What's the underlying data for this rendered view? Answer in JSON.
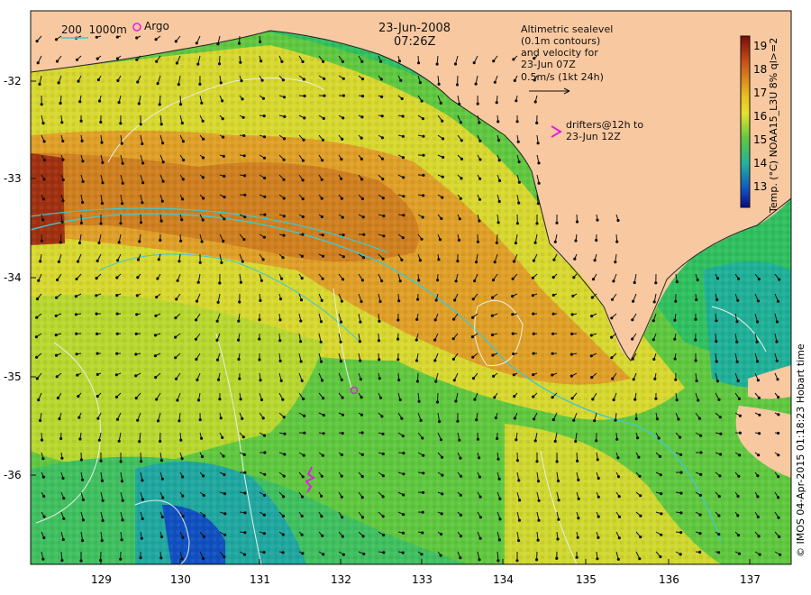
{
  "map": {
    "date": "23-Jun-2008",
    "time": "07:26Z",
    "scale_label": "200  1000m",
    "argo_label": "Argo",
    "legend_lines": [
      "Altimetric sealevel",
      "(0.1m contours)",
      "and velocity for",
      "23-Jun 07Z",
      "0.5m/s (1kt 24h)"
    ],
    "drifters_lines": [
      "drifters@12h to",
      "23-Jun 12Z"
    ],
    "y_ticks": [
      "-32",
      "-33",
      "-34",
      "-35",
      "-36"
    ],
    "x_ticks": [
      "129",
      "130",
      "131",
      "132",
      "133",
      "134",
      "135",
      "136",
      "137"
    ],
    "colorbar": {
      "title": "Temp. (°C) NOAA15_L3U 8% ql>=2",
      "ticks": [
        "19",
        "18",
        "17",
        "16",
        "15",
        "14",
        "13"
      ],
      "colors": [
        "#7a0a0a",
        "#c8501a",
        "#e0a020",
        "#e8e030",
        "#60c840",
        "#20b0a0",
        "#1050c0",
        "#0a0a80"
      ]
    },
    "credit": "© IMOS 04-Apr-2015 01:18:23 Hobart time",
    "colors": {
      "land": "#f8c8a0",
      "sea_warm": "#e0a028",
      "sea_mid": "#b8d830",
      "sea_cool": "#30c860",
      "contour": "#40c8d0",
      "drifter": "#e020e0"
    }
  }
}
